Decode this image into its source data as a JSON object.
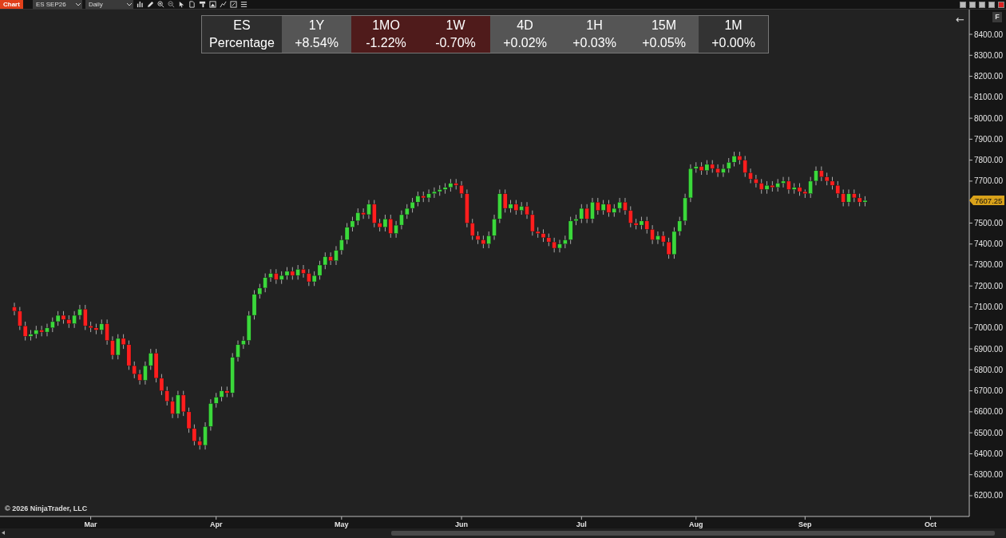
{
  "toolbar": {
    "title": "Chart",
    "instrument": "ES SEP26",
    "interval": "Daily"
  },
  "performance_table": {
    "columns": [
      {
        "label": "ES",
        "value": "Percentage",
        "color": "#2e2e2e"
      },
      {
        "label": "1Y",
        "value": "+8.54%",
        "color": "#555555"
      },
      {
        "label": "1MO",
        "value": "-1.22%",
        "color": "#4f1b1b"
      },
      {
        "label": "1W",
        "value": "-0.70%",
        "color": "#4f1b1b"
      },
      {
        "label": "4D",
        "value": "+0.02%",
        "color": "#555555"
      },
      {
        "label": "1H",
        "value": "+0.03%",
        "color": "#555555"
      },
      {
        "label": "15M",
        "value": "+0.05%",
        "color": "#555555"
      },
      {
        "label": "1M",
        "value": "+0.00%",
        "color": "#333333"
      }
    ]
  },
  "chart": {
    "back_button": "←",
    "f_button": "F",
    "copyright": "© 2026 NinjaTrader, LLC",
    "last_price": "7607.25",
    "chart_data": {
      "type": "candlestick",
      "ylim": [
        6101,
        8518
      ],
      "categories": [
        null,
        null,
        null,
        null,
        null,
        null,
        null,
        null,
        null,
        null,
        null,
        null,
        null,
        null,
        "Mar",
        null,
        null,
        null,
        null,
        null,
        null,
        null,
        null,
        null,
        null,
        null,
        null,
        null,
        null,
        null,
        null,
        null,
        null,
        null,
        null,
        null,
        null,
        "Apr",
        null,
        null,
        null,
        null,
        null,
        null,
        null,
        null,
        null,
        null,
        null,
        null,
        null,
        null,
        null,
        null,
        null,
        null,
        null,
        null,
        null,
        null,
        "May",
        null,
        null,
        null,
        null,
        null,
        null,
        null,
        null,
        null,
        null,
        null,
        null,
        null,
        null,
        null,
        null,
        null,
        null,
        null,
        null,
        null,
        "Jun",
        null,
        null,
        null,
        null,
        null,
        null,
        null,
        null,
        null,
        null,
        null,
        null,
        null,
        null,
        null,
        null,
        null,
        null,
        null,
        null,
        null,
        "Jul",
        null,
        null,
        null,
        null,
        null,
        null,
        null,
        null,
        null,
        null,
        null,
        null,
        null,
        null,
        null,
        null,
        null,
        null,
        null,
        null,
        "Aug",
        null,
        null,
        null,
        null,
        null,
        null,
        null,
        null,
        null,
        null,
        null,
        null,
        null,
        null,
        null,
        null,
        null,
        null,
        null,
        "Sep",
        null,
        null,
        null,
        null,
        null,
        null,
        null,
        null,
        null,
        null,
        null,
        null,
        null,
        null,
        null,
        null,
        null,
        null,
        null,
        null,
        null,
        null,
        "Oct"
      ],
      "yticks": [
        {
          "value": 6200,
          "label": "6200.00"
        },
        {
          "value": 6300,
          "label": "6300.00"
        },
        {
          "value": 6400,
          "label": "6400.00"
        },
        {
          "value": 6500,
          "label": "6500.00"
        },
        {
          "value": 6600,
          "label": "6600.00"
        },
        {
          "value": 6700,
          "label": "6700.00"
        },
        {
          "value": 6800,
          "label": "6800.00"
        },
        {
          "value": 6900,
          "label": "6900.00"
        },
        {
          "value": 7000,
          "label": "7000.00"
        },
        {
          "value": 7100,
          "label": "7100.00"
        },
        {
          "value": 7200,
          "label": "7200.00"
        },
        {
          "value": 7300,
          "label": "7300.00"
        },
        {
          "value": 7400,
          "label": "7400.00"
        },
        {
          "value": 7500,
          "label": "7500.00"
        },
        {
          "value": 7700,
          "label": "7700.00"
        },
        {
          "value": 7800,
          "label": "7800.00"
        },
        {
          "value": 7900,
          "label": "7900.00"
        },
        {
          "value": 8000,
          "label": "8000.00"
        },
        {
          "value": 8100,
          "label": "8100.00"
        },
        {
          "value": 8200,
          "label": "8200.00"
        },
        {
          "value": 8300,
          "label": "8300.00"
        },
        {
          "value": 8400,
          "label": "8400.00"
        }
      ],
      "ohlc": [
        [
          7100,
          7120,
          7060,
          7080
        ],
        [
          7080,
          7100,
          6990,
          7010
        ],
        [
          7010,
          7030,
          6940,
          6960
        ],
        [
          6960,
          6990,
          6940,
          6970
        ],
        [
          6970,
          7010,
          6950,
          6990
        ],
        [
          6990,
          7010,
          6960,
          6980
        ],
        [
          6980,
          7020,
          6960,
          7000
        ],
        [
          7000,
          7050,
          6980,
          7030
        ],
        [
          7030,
          7080,
          7010,
          7060
        ],
        [
          7060,
          7080,
          7020,
          7040
        ],
        [
          7040,
          7060,
          7000,
          7020
        ],
        [
          7020,
          7080,
          7000,
          7060
        ],
        [
          7060,
          7110,
          7040,
          7090
        ],
        [
          7090,
          7110,
          6990,
          7010
        ],
        [
          7010,
          7030,
          6980,
          7000
        ],
        [
          7000,
          7020,
          6970,
          6990
        ],
        [
          6990,
          7040,
          6970,
          7020
        ],
        [
          7020,
          7040,
          6920,
          6940
        ],
        [
          6940,
          6960,
          6850,
          6870
        ],
        [
          6870,
          6970,
          6850,
          6950
        ],
        [
          6950,
          6970,
          6900,
          6920
        ],
        [
          6920,
          6940,
          6800,
          6820
        ],
        [
          6820,
          6840,
          6760,
          6780
        ],
        [
          6780,
          6800,
          6730,
          6750
        ],
        [
          6750,
          6840,
          6730,
          6820
        ],
        [
          6820,
          6900,
          6800,
          6880
        ],
        [
          6880,
          6900,
          6740,
          6760
        ],
        [
          6760,
          6780,
          6680,
          6700
        ],
        [
          6700,
          6720,
          6630,
          6650
        ],
        [
          6650,
          6670,
          6570,
          6590
        ],
        [
          6590,
          6700,
          6570,
          6680
        ],
        [
          6680,
          6700,
          6580,
          6600
        ],
        [
          6600,
          6620,
          6500,
          6520
        ],
        [
          6520,
          6540,
          6440,
          6460
        ],
        [
          6460,
          6480,
          6420,
          6440
        ],
        [
          6440,
          6550,
          6420,
          6530
        ],
        [
          6530,
          6660,
          6510,
          6640
        ],
        [
          6640,
          6690,
          6620,
          6670
        ],
        [
          6670,
          6720,
          6650,
          6700
        ],
        [
          6700,
          6720,
          6670,
          6690
        ],
        [
          6690,
          6880,
          6670,
          6860
        ],
        [
          6860,
          6940,
          6840,
          6920
        ],
        [
          6920,
          6960,
          6900,
          6940
        ],
        [
          6940,
          7080,
          6920,
          7060
        ],
        [
          7060,
          7180,
          7040,
          7160
        ],
        [
          7160,
          7210,
          7140,
          7190
        ],
        [
          7190,
          7260,
          7170,
          7240
        ],
        [
          7240,
          7280,
          7220,
          7260
        ],
        [
          7260,
          7280,
          7210,
          7230
        ],
        [
          7230,
          7270,
          7210,
          7250
        ],
        [
          7250,
          7290,
          7230,
          7270
        ],
        [
          7270,
          7290,
          7230,
          7250
        ],
        [
          7250,
          7300,
          7230,
          7280
        ],
        [
          7280,
          7300,
          7240,
          7260
        ],
        [
          7260,
          7280,
          7200,
          7220
        ],
        [
          7220,
          7270,
          7200,
          7250
        ],
        [
          7250,
          7320,
          7230,
          7300
        ],
        [
          7300,
          7360,
          7280,
          7340
        ],
        [
          7340,
          7360,
          7300,
          7320
        ],
        [
          7320,
          7390,
          7300,
          7370
        ],
        [
          7370,
          7440,
          7350,
          7420
        ],
        [
          7420,
          7500,
          7400,
          7480
        ],
        [
          7480,
          7530,
          7460,
          7510
        ],
        [
          7510,
          7570,
          7490,
          7550
        ],
        [
          7550,
          7570,
          7520,
          7540
        ],
        [
          7540,
          7610,
          7520,
          7590
        ],
        [
          7590,
          7610,
          7480,
          7500
        ],
        [
          7500,
          7520,
          7460,
          7480
        ],
        [
          7480,
          7540,
          7460,
          7520
        ],
        [
          7520,
          7540,
          7430,
          7450
        ],
        [
          7450,
          7510,
          7430,
          7490
        ],
        [
          7490,
          7560,
          7470,
          7540
        ],
        [
          7540,
          7590,
          7520,
          7570
        ],
        [
          7570,
          7620,
          7550,
          7600
        ],
        [
          7600,
          7650,
          7580,
          7630
        ],
        [
          7630,
          7650,
          7600,
          7620
        ],
        [
          7620,
          7660,
          7600,
          7640
        ],
        [
          7640,
          7670,
          7620,
          7650
        ],
        [
          7650,
          7680,
          7630,
          7660
        ],
        [
          7660,
          7690,
          7640,
          7670
        ],
        [
          7670,
          7710,
          7650,
          7690
        ],
        [
          7690,
          7710,
          7660,
          7680
        ],
        [
          7680,
          7700,
          7620,
          7640
        ],
        [
          7640,
          7660,
          7480,
          7500
        ],
        [
          7500,
          7520,
          7420,
          7440
        ],
        [
          7440,
          7460,
          7400,
          7420
        ],
        [
          7420,
          7440,
          7380,
          7400
        ],
        [
          7400,
          7460,
          7380,
          7440
        ],
        [
          7440,
          7540,
          7420,
          7520
        ],
        [
          7520,
          7660,
          7500,
          7640
        ],
        [
          7640,
          7660,
          7550,
          7570
        ],
        [
          7570,
          7610,
          7550,
          7590
        ],
        [
          7590,
          7610,
          7540,
          7560
        ],
        [
          7560,
          7600,
          7540,
          7580
        ],
        [
          7580,
          7600,
          7520,
          7540
        ],
        [
          7540,
          7560,
          7440,
          7460
        ],
        [
          7460,
          7480,
          7430,
          7450
        ],
        [
          7450,
          7470,
          7410,
          7430
        ],
        [
          7430,
          7450,
          7390,
          7410
        ],
        [
          7410,
          7430,
          7360,
          7380
        ],
        [
          7380,
          7420,
          7360,
          7400
        ],
        [
          7400,
          7440,
          7380,
          7420
        ],
        [
          7420,
          7530,
          7400,
          7510
        ],
        [
          7510,
          7540,
          7490,
          7520
        ],
        [
          7520,
          7590,
          7500,
          7570
        ],
        [
          7570,
          7590,
          7500,
          7520
        ],
        [
          7520,
          7620,
          7500,
          7600
        ],
        [
          7600,
          7620,
          7540,
          7560
        ],
        [
          7560,
          7610,
          7540,
          7590
        ],
        [
          7590,
          7610,
          7530,
          7550
        ],
        [
          7550,
          7590,
          7530,
          7570
        ],
        [
          7570,
          7620,
          7550,
          7600
        ],
        [
          7600,
          7620,
          7540,
          7560
        ],
        [
          7560,
          7580,
          7480,
          7500
        ],
        [
          7500,
          7520,
          7470,
          7490
        ],
        [
          7490,
          7530,
          7470,
          7510
        ],
        [
          7510,
          7530,
          7450,
          7470
        ],
        [
          7470,
          7490,
          7400,
          7420
        ],
        [
          7420,
          7460,
          7400,
          7440
        ],
        [
          7440,
          7460,
          7390,
          7410
        ],
        [
          7410,
          7430,
          7330,
          7350
        ],
        [
          7350,
          7480,
          7330,
          7460
        ],
        [
          7460,
          7530,
          7440,
          7510
        ],
        [
          7510,
          7640,
          7490,
          7620
        ],
        [
          7620,
          7780,
          7600,
          7760
        ],
        [
          7760,
          7790,
          7740,
          7770
        ],
        [
          7770,
          7790,
          7730,
          7750
        ],
        [
          7750,
          7800,
          7730,
          7780
        ],
        [
          7780,
          7800,
          7740,
          7760
        ],
        [
          7760,
          7780,
          7720,
          7740
        ],
        [
          7740,
          7780,
          7720,
          7760
        ],
        [
          7760,
          7810,
          7740,
          7790
        ],
        [
          7790,
          7840,
          7770,
          7820
        ],
        [
          7820,
          7840,
          7780,
          7800
        ],
        [
          7800,
          7820,
          7720,
          7740
        ],
        [
          7740,
          7760,
          7690,
          7710
        ],
        [
          7710,
          7730,
          7670,
          7690
        ],
        [
          7690,
          7710,
          7640,
          7660
        ],
        [
          7660,
          7700,
          7640,
          7680
        ],
        [
          7680,
          7700,
          7650,
          7670
        ],
        [
          7670,
          7710,
          7650,
          7690
        ],
        [
          7690,
          7720,
          7670,
          7700
        ],
        [
          7700,
          7720,
          7640,
          7660
        ],
        [
          7660,
          7690,
          7640,
          7670
        ],
        [
          7670,
          7690,
          7630,
          7650
        ],
        [
          7650,
          7660,
          7620,
          7640
        ],
        [
          7640,
          7720,
          7620,
          7700
        ],
        [
          7700,
          7770,
          7680,
          7750
        ],
        [
          7750,
          7770,
          7700,
          7720
        ],
        [
          7720,
          7740,
          7680,
          7700
        ],
        [
          7700,
          7720,
          7660,
          7680
        ],
        [
          7680,
          7700,
          7620,
          7640
        ],
        [
          7640,
          7660,
          7580,
          7600
        ],
        [
          7600,
          7660,
          7580,
          7640
        ],
        [
          7640,
          7660,
          7600,
          7620
        ],
        [
          7620,
          7640,
          7580,
          7600
        ],
        [
          7600,
          7628,
          7580,
          7608
        ],
        null,
        null,
        null,
        null,
        null,
        null,
        null,
        null,
        null,
        null,
        null,
        null
      ]
    }
  }
}
